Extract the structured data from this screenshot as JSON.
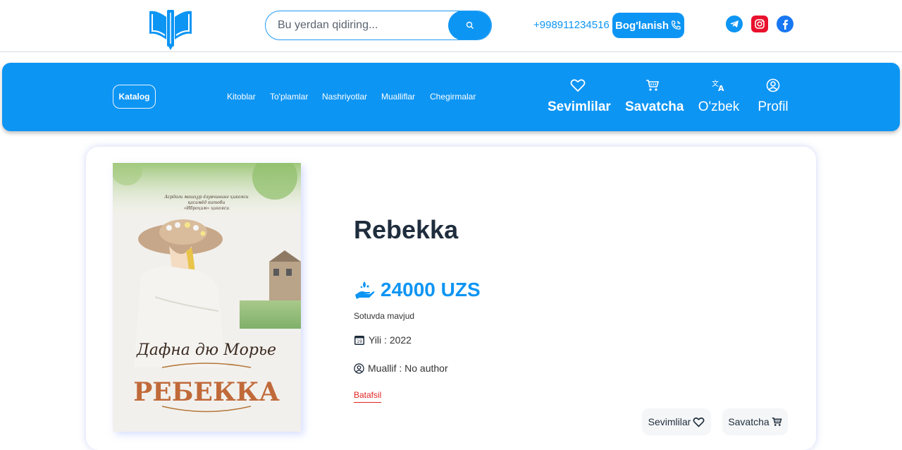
{
  "header": {
    "search_placeholder": "Bu yerdan qidiring...",
    "phone": "+998911234516",
    "contact_label": "Bog'lanish",
    "social": [
      "telegram-icon",
      "instagram-icon",
      "facebook-icon"
    ]
  },
  "nav": {
    "katalog": "Katalog",
    "links": [
      "Kitoblar",
      "To'plamlar",
      "Nashriyotlar",
      "Mualliflar",
      "Chegirmalar"
    ],
    "actions": [
      {
        "label": "Sevimlilar",
        "icon": "heart-icon"
      },
      {
        "label": "Savatcha",
        "icon": "cart-icon"
      },
      {
        "label": "O'zbek",
        "icon": "translate-icon"
      },
      {
        "label": "Profil",
        "icon": "user-icon"
      }
    ]
  },
  "product": {
    "title": "Rebekka",
    "price": "24000 UZS",
    "stock": "Sotuvda mavjud",
    "year": "Yili : 2022",
    "author": "Muallif : No author",
    "more": "Batafsil",
    "fav_button": "Sevimlilar",
    "cart_button": "Savatcha",
    "cover": {
      "top_text_1": "Асрдаги машҳур ёзувчининг ҳикояси",
      "top_text_2": "қасамёд китоби",
      "top_text_3": "«Иброҳим» ҳикояси",
      "author": "Дафна дю Морье",
      "title": "РЕБЕККА"
    }
  },
  "colors": {
    "accent": "#0d95f4",
    "link_red": "#e02424",
    "text_dark": "#1f2d3d"
  }
}
